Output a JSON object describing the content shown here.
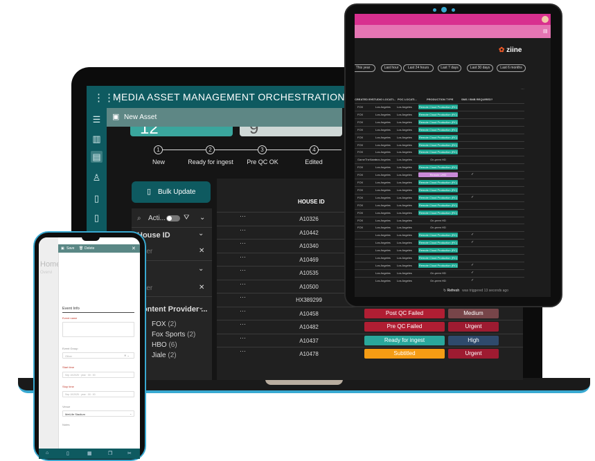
{
  "laptop": {
    "app_title": "MEDIA ASSET MANAGEMENT ORCHESTRATION",
    "new_asset_label": "New Asset",
    "card_a_value": "12",
    "card_b_value": "9",
    "steps": [
      {
        "num": "1",
        "label": "New"
      },
      {
        "num": "2",
        "label": "Ready for ingest"
      },
      {
        "num": "3",
        "label": "Pre QC OK"
      },
      {
        "num": "4",
        "label": "Edited"
      }
    ],
    "bulk_update_label": "Bulk Update",
    "filter": {
      "search_label": "Acti...",
      "sections": [
        {
          "label": "House ID",
          "placeholder": "Filter"
        },
        {
          "label": "",
          "placeholder": "Filter"
        },
        {
          "label": "Content Provider ...",
          "placeholder": ""
        }
      ],
      "providers": [
        {
          "name": "FOX",
          "count": "(2)"
        },
        {
          "name": "Fox Sports",
          "count": "(2)"
        },
        {
          "name": "HBO",
          "count": "(6)"
        },
        {
          "name": "Jiale",
          "count": "(2)"
        }
      ]
    },
    "table": {
      "header_house_id": "HOUSE ID",
      "rows": [
        {
          "house_id": "A10326",
          "status": "",
          "priority": ""
        },
        {
          "house_id": "A10442",
          "status": "",
          "priority": ""
        },
        {
          "house_id": "A10340",
          "status": "",
          "priority": ""
        },
        {
          "house_id": "A10469",
          "status": "",
          "priority": ""
        },
        {
          "house_id": "A10535",
          "status": "",
          "priority": ""
        },
        {
          "house_id": "A10500",
          "status": "",
          "priority": ""
        },
        {
          "house_id": "HX389299",
          "status": "",
          "priority": ""
        },
        {
          "house_id": "A10458",
          "status": "Post QC Failed",
          "priority": "Medium"
        },
        {
          "house_id": "A10482",
          "status": "Pre QC Failed",
          "priority": "Urgent"
        },
        {
          "house_id": "A10437",
          "status": "Ready for ingest",
          "priority": "High"
        },
        {
          "house_id": "A10478",
          "status": "Subtitled",
          "priority": "Urgent"
        }
      ]
    }
  },
  "tablet": {
    "brand": "ziine",
    "time_filters": [
      "This year",
      "Last hour",
      "Last 24 hours",
      "Last 7 days",
      "Last 30 days",
      "Last 6 months"
    ],
    "columns": [
      "CREATED BY",
      "STUDIO LOCATI...",
      "POC LOCATI...",
      "PRODUCTION TYPE",
      "SMS / BNB REQUIRED?"
    ],
    "rows": [
      {
        "a": "FOX",
        "b": "Los Angeles",
        "c": "Los Angeles",
        "type": "Remote Cloud Production (RC)",
        "check": ""
      },
      {
        "a": "FOX",
        "b": "Los Angeles",
        "c": "Los Angeles",
        "type": "Remote Cloud Production (RC)",
        "check": ""
      },
      {
        "a": "FOX",
        "b": "Los Angeles",
        "c": "Los Angeles",
        "type": "Remote Cloud Production (RC)",
        "check": ""
      },
      {
        "a": "FOX",
        "b": "Los Angeles",
        "c": "Los Angeles",
        "type": "Remote Cloud Production (RC)",
        "check": ""
      },
      {
        "a": "FOX",
        "b": "Los Angeles",
        "c": "Los Angeles",
        "type": "Remote Cloud Production (RC)",
        "check": ""
      },
      {
        "a": "FOX",
        "b": "Los Angeles",
        "c": "Los Angeles",
        "type": "Remote Cloud Production (RC)",
        "check": ""
      },
      {
        "a": "FOX",
        "b": "Los Angeles",
        "c": "Los Angeles",
        "type": "Remote Cloud Production (RC)",
        "check": ""
      },
      {
        "a": "GameTheName",
        "b": "Los Angeles",
        "c": "Los Angeles",
        "type": "On-prem HD",
        "check": ""
      },
      {
        "a": "FOX",
        "b": "Los Angeles",
        "c": "Los Angeles",
        "type": "Remote Cloud Production (RC)",
        "check": ""
      },
      {
        "a": "FOX",
        "b": "Los Angeles",
        "c": "Los Angeles",
        "type": "Remote UHD",
        "check": "✓"
      },
      {
        "a": "FOX",
        "b": "Los Angeles",
        "c": "Los Angeles",
        "type": "Remote Cloud Production (RC)",
        "check": ""
      },
      {
        "a": "FOX",
        "b": "Los Angeles",
        "c": "Los Angeles",
        "type": "Remote Cloud Production (RC)",
        "check": ""
      },
      {
        "a": "FOX",
        "b": "Los Angeles",
        "c": "Los Angeles",
        "type": "Remote Cloud Production (RC)",
        "check": "✓"
      },
      {
        "a": "FOX",
        "b": "Los Angeles",
        "c": "Los Angeles",
        "type": "Remote Cloud Production (RC)",
        "check": ""
      },
      {
        "a": "FOX",
        "b": "Los Angeles",
        "c": "Los Angeles",
        "type": "Remote Cloud Production (RC)",
        "check": ""
      },
      {
        "a": "FOX",
        "b": "Los Angeles",
        "c": "Los Angeles",
        "type": "On-prem HD",
        "check": ""
      },
      {
        "a": "FOX",
        "b": "Los Angeles",
        "c": "Los Angeles",
        "type": "On-prem HD",
        "check": ""
      },
      {
        "a": "",
        "b": "Los Angeles",
        "c": "Los Angeles",
        "type": "Remote Cloud Production (RC)",
        "check": "✓"
      },
      {
        "a": "",
        "b": "Los Angeles",
        "c": "Los Angeles",
        "type": "Remote Cloud Production (RC)",
        "check": "✓"
      },
      {
        "a": "",
        "b": "Los Angeles",
        "c": "Los Angeles",
        "type": "Remote Cloud Production (RC)",
        "check": ""
      },
      {
        "a": "",
        "b": "Los Angeles",
        "c": "Los Angeles",
        "type": "Remote Cloud Production (RC)",
        "check": ""
      },
      {
        "a": "",
        "b": "Los Angeles",
        "c": "Los Angeles",
        "type": "Remote Cloud Production (RC)",
        "check": "✓"
      },
      {
        "a": "",
        "b": "Los Angeles",
        "c": "Los Angeles",
        "type": "On-prem HD",
        "check": "✓"
      },
      {
        "a": "",
        "b": "Los Angeles",
        "c": "Los Angeles",
        "type": "On-prem HD",
        "check": "✓"
      }
    ],
    "refresh_label": "Refresh",
    "refresh_note": "was triggered 13 seconds ago"
  },
  "phone": {
    "save_label": "Save",
    "delete_label": "Delete",
    "bg_title": "Home",
    "bg_sub": "Overvi",
    "section_title": "Event Info",
    "event_name_label": "Event name",
    "event_group_label": "Event Group",
    "event_group_placeholder": "Other",
    "start_label": "Start time",
    "start_placeholder": "Sep 10/2025  ·  year  ·  00 : 00",
    "stop_label": "Stop time",
    "stop_placeholder": "Sep 10/2025  ·  year  ·  00 : 00",
    "venue_label": "Venue",
    "venue_value": "MetLife Stadium",
    "notes_label": "Notes"
  },
  "colors": {
    "teal": "#0e5a60",
    "post_qc_failed": "#b01e33",
    "pre_qc_failed": "#b01e33",
    "ready_for_ingest": "#2aa79b",
    "subtitled": "#f59c14",
    "medium": "#774549",
    "urgent": "#9e1b31",
    "high": "#2f4a6c",
    "remote_cloud": "#17a58f",
    "remote_uhd": "#c98ad8",
    "pink": "#d8308f"
  }
}
